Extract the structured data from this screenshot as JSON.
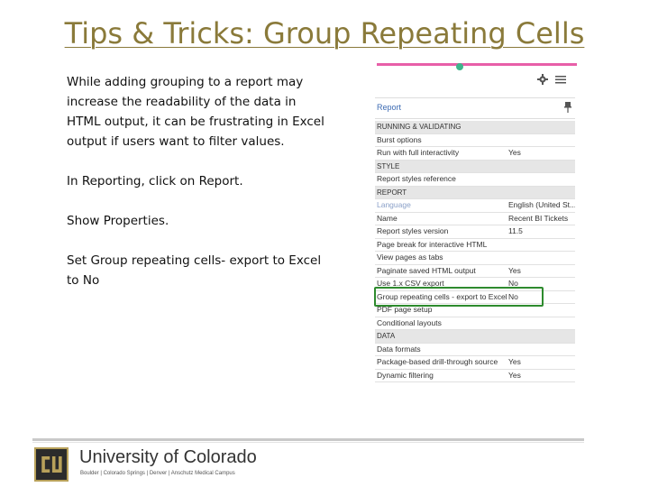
{
  "slide": {
    "title": "Tips & Tricks: Group Repeating Cells",
    "paragraphs": [
      "While adding grouping to a report may increase the readability of the data in HTML output, it can be frustrating in Excel output if users want to filter values.",
      "In Reporting, click on Report.",
      "Show Properties.",
      "Set Group repeating cells- export to Excel to No"
    ]
  },
  "panel": {
    "header_label": "Report",
    "toolbar_icons": [
      "gear-icon",
      "properties-icon"
    ],
    "pin_icon": "pin-icon",
    "rows": [
      {
        "key": "RUNNING & VALIDATING",
        "value": "",
        "section": true
      },
      {
        "key": "Burst options",
        "value": ""
      },
      {
        "key": "Run with full interactivity",
        "value": "Yes"
      },
      {
        "key": "STYLE",
        "value": "",
        "section": true
      },
      {
        "key": "Report styles reference",
        "value": ""
      },
      {
        "key": "REPORT",
        "value": "",
        "section": true
      },
      {
        "key": "Language",
        "value": "English (United St...",
        "muted": true
      },
      {
        "key": "Name",
        "value": "Recent BI Tickets"
      },
      {
        "key": "Report styles version",
        "value": "11.5"
      },
      {
        "key": "Page break for interactive HTML",
        "value": ""
      },
      {
        "key": "View pages as tabs",
        "value": ""
      },
      {
        "key": "Paginate saved HTML output",
        "value": "Yes"
      },
      {
        "key": "Use 1.x CSV export",
        "value": "No"
      },
      {
        "key": "Group repeating cells - export to Excel",
        "value": "No",
        "highlight": true
      },
      {
        "key": "PDF page setup",
        "value": ""
      },
      {
        "key": "Conditional layouts",
        "value": ""
      },
      {
        "key": "DATA",
        "value": "",
        "section": true
      },
      {
        "key": "Data formats",
        "value": ""
      },
      {
        "key": "Package-based drill-through source",
        "value": "Yes"
      },
      {
        "key": "Dynamic filtering",
        "value": "Yes"
      }
    ]
  },
  "footer": {
    "university": "University of Colorado",
    "campuses": "Boulder | Colorado Springs | Denver | Anschutz Medical Campus"
  },
  "colors": {
    "title": "#8a7a3a",
    "accent_bar": "#e85fa8",
    "highlight": "#2e8b2e",
    "link": "#3d6bb3"
  }
}
